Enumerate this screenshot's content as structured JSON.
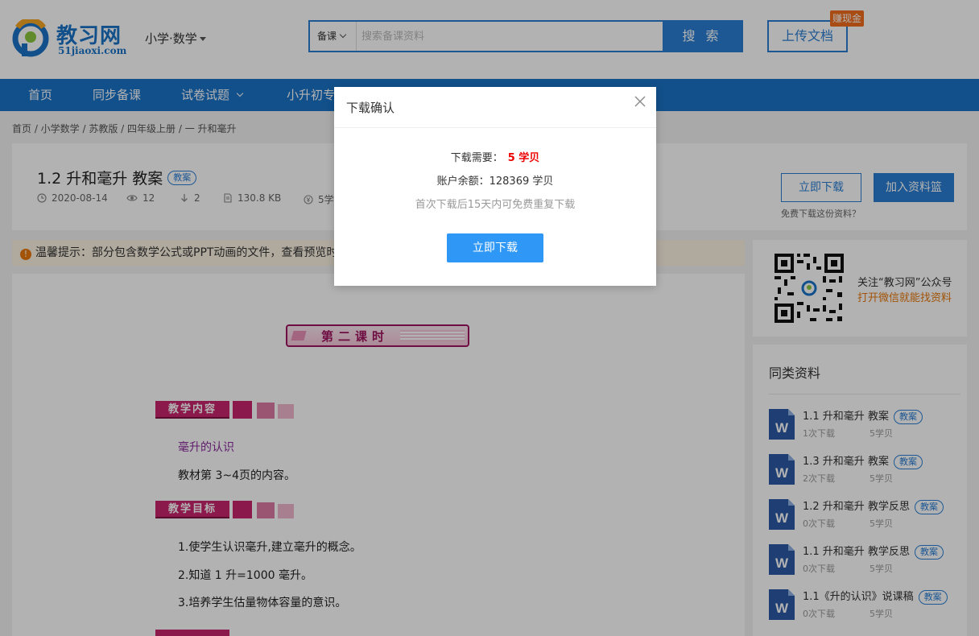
{
  "header": {
    "logo_name": "教习网",
    "logo_domain": "51jiaoxi.com",
    "subject": "小学·数学",
    "search_type": "备课",
    "search_placeholder": "搜索备课资料",
    "search_button": "搜 索",
    "upload_button": "上传文档",
    "earn_badge": "赚现金",
    "brand_color": "#1a73c8"
  },
  "nav": {
    "items": [
      "首页",
      "同步备课",
      "试卷试题",
      "小升初专"
    ]
  },
  "breadcrumb": "首页 / 小学数学 / 苏教版 / 四年级上册 / 一 升和毫升",
  "document": {
    "title": "1.2 升和毫升 教案",
    "tag": "教案",
    "date": "2020-08-14",
    "views": "12",
    "downloads": "2",
    "size": "130.8 KB",
    "price": "5学",
    "download_button": "立即下载",
    "basket_button": "加入资料篮",
    "free_link": "免费下载这份资料？"
  },
  "notice": {
    "icon": "!",
    "text": "温馨提示：部分包含数学公式或PPT动画的文件，查看预览时"
  },
  "preview": {
    "banner": "第二课时",
    "sections": [
      {
        "heading": "教学内容",
        "lines": [
          "毫升的认识",
          "教材第 3~4页的内容。"
        ]
      },
      {
        "heading": "教学目标",
        "lines": [
          "1.使学生认识毫升,建立毫升的概念。",
          "2.知道 1 升=1000 毫升。",
          "3.培养学生估量物体容量的意识。"
        ]
      }
    ]
  },
  "qr": {
    "line1": "关注“教习网”公众号",
    "line2": "打开微信就能找资料"
  },
  "related": {
    "title": "同类资料",
    "items": [
      {
        "title": "1.1 升和毫升 教案",
        "tag": "教案",
        "downloads": "1次下载",
        "price": "5学贝"
      },
      {
        "title": "1.3 升和毫升 教案",
        "tag": "教案",
        "downloads": "2次下载",
        "price": "5学贝"
      },
      {
        "title": "1.2 升和毫升 教学反思",
        "tag": "教案",
        "downloads": "0次下载",
        "price": "5学贝"
      },
      {
        "title": "1.1 升和毫升 教学反思",
        "tag": "教案",
        "downloads": "0次下载",
        "price": "5学贝"
      },
      {
        "title": "1.1《升的认识》说课稿",
        "tag": "教案",
        "downloads": "0次下载",
        "price": "5学贝"
      }
    ]
  },
  "modal": {
    "title": "下载确认",
    "need_label": "下载需要：",
    "need_value": "5 学贝",
    "balance": "账户余额：128369 学贝",
    "hint": "首次下载后15天内可免费重复下载",
    "button": "立即下载"
  }
}
